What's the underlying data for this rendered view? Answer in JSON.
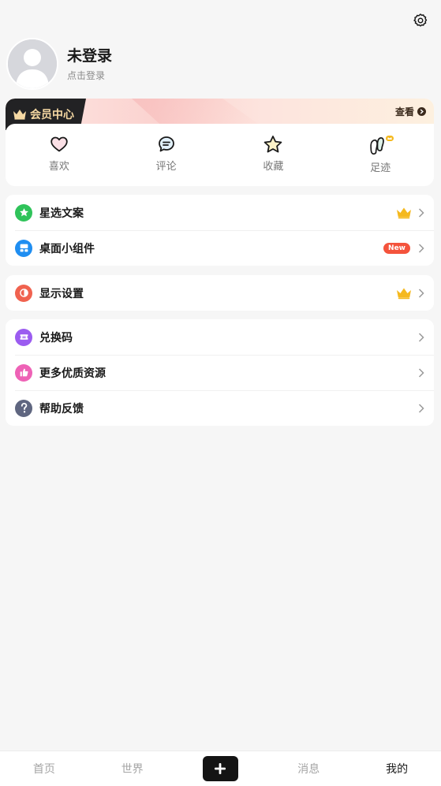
{
  "header": {
    "settings_icon": "gear-icon"
  },
  "profile": {
    "username": "未登录",
    "login_hint": "点击登录"
  },
  "vip": {
    "title": "会员中心",
    "view_label": "查看",
    "quick_actions": [
      {
        "label": "喜欢",
        "icon": "heart-icon"
      },
      {
        "label": "评论",
        "icon": "comment-icon"
      },
      {
        "label": "收藏",
        "icon": "star-icon"
      },
      {
        "label": "足迹",
        "icon": "footprint-icon"
      }
    ]
  },
  "menu": {
    "group1": [
      {
        "label": "星选文案",
        "icon": "star-badge-icon",
        "color": "#2fc35a",
        "badge": "crown"
      },
      {
        "label": "桌面小组件",
        "icon": "widget-icon",
        "color": "#1f8ef1",
        "badge": "New"
      }
    ],
    "group2": [
      {
        "label": "显示设置",
        "icon": "contrast-icon",
        "color": "#f0624f",
        "badge": "crown"
      }
    ],
    "group3": [
      {
        "label": "兑换码",
        "icon": "ticket-icon",
        "color": "#9b5cf0"
      },
      {
        "label": "更多优质资源",
        "icon": "thumbs-up-icon",
        "color": "#ee62b6"
      },
      {
        "label": "帮助反馈",
        "icon": "help-icon",
        "color": "#5f6680"
      }
    ]
  },
  "tabbar": {
    "tabs": [
      {
        "label": "首页"
      },
      {
        "label": "世界"
      },
      {
        "label": "消息"
      },
      {
        "label": "我的"
      }
    ]
  },
  "colors": {
    "accent_dark": "#141414",
    "vip_gold": "#f6d9a3",
    "new_badge": "#f4533c",
    "crown_gold": "#f5b91e"
  }
}
